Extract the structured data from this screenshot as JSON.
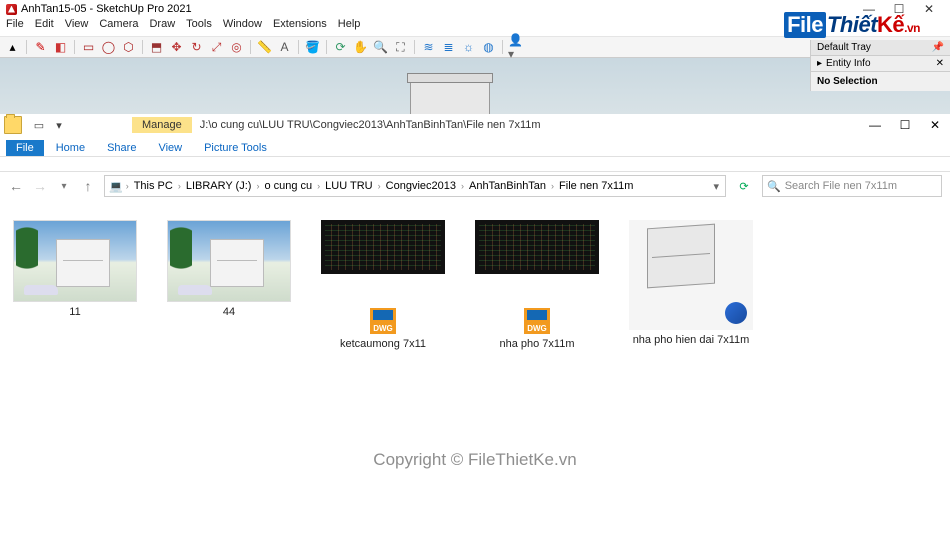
{
  "sketchup": {
    "title": "AnhTan15-05 - SketchUp Pro 2021",
    "menu": [
      "File",
      "Edit",
      "View",
      "Camera",
      "Draw",
      "Tools",
      "Window",
      "Extensions",
      "Help"
    ],
    "tray": {
      "title": "Default Tray",
      "section": "Entity Info",
      "body": "No Selection"
    },
    "window_controls": {
      "min": "—",
      "max": "☐",
      "close": "✕"
    }
  },
  "watermark": {
    "part1": "File",
    "part2": "Thiết",
    "part3": "Kế",
    "part4": ".vn"
  },
  "explorer": {
    "ribbon_tabs": {
      "file": "File",
      "home": "Home",
      "share": "Share",
      "view": "View",
      "context_group": "Manage",
      "context_sub": "Picture Tools"
    },
    "path_text": "J:\\o cung cu\\LUU TRU\\Congviec2013\\AnhTanBinhTan\\File nen 7x11m",
    "breadcrumb": [
      "This PC",
      "LIBRARY (J:)",
      "o cung cu",
      "LUU TRU",
      "Congviec2013",
      "AnhTanBinhTan",
      "File nen 7x11m"
    ],
    "search_placeholder": "Search File nen 7x11m",
    "files": [
      {
        "name": "11",
        "type": "render"
      },
      {
        "name": "44",
        "type": "render"
      },
      {
        "name": "ketcaumong 7x11",
        "type": "dwg",
        "badge": "DWG"
      },
      {
        "name": "nha pho 7x11m",
        "type": "dwg",
        "badge": "DWG"
      },
      {
        "name": "nha pho hien dai 7x11m",
        "type": "skp"
      }
    ],
    "window_controls": {
      "min": "—",
      "max": "☐",
      "close": "✕"
    }
  },
  "copyright": "Copyright © FileThietKe.vn"
}
